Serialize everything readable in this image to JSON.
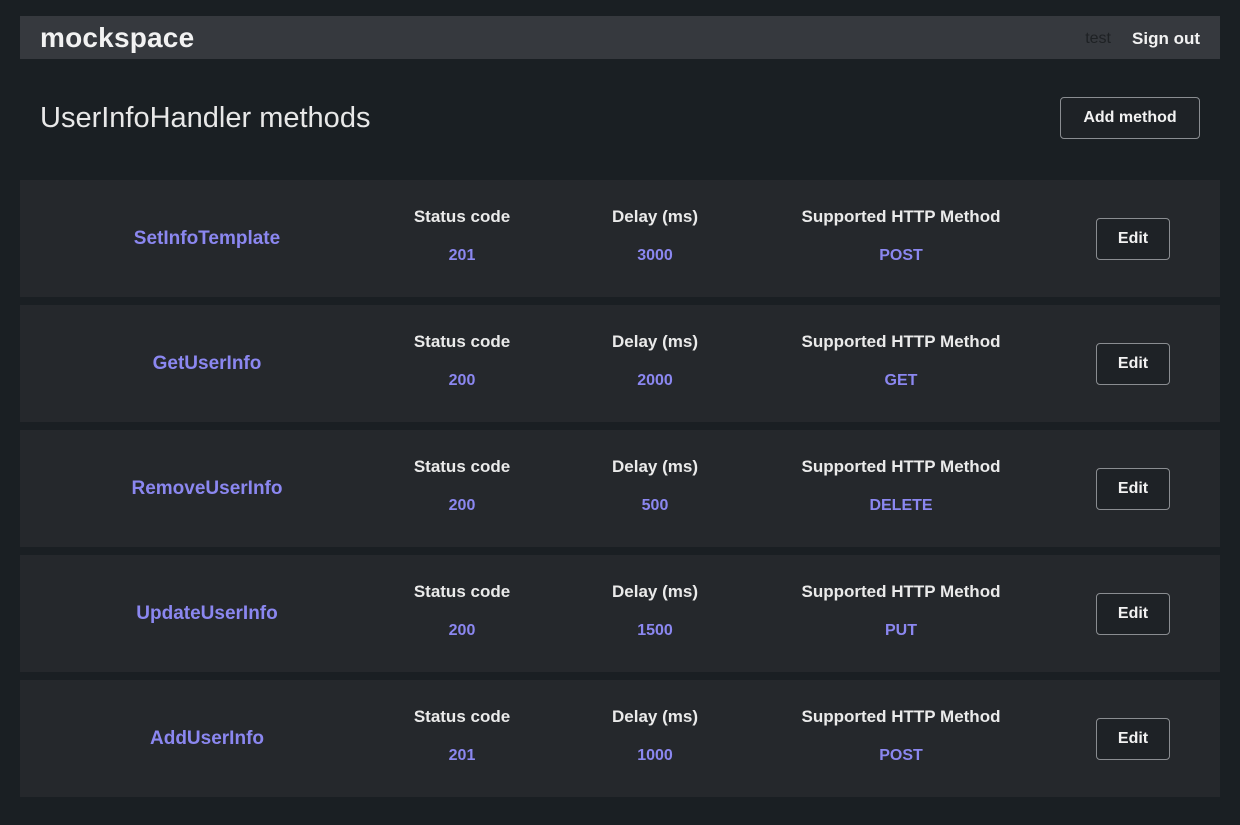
{
  "navbar": {
    "brand": "mockspace",
    "user": "test",
    "signout_label": "Sign out"
  },
  "header": {
    "title": "UserInfoHandler methods",
    "add_method_label": "Add method"
  },
  "labels": {
    "status_code": "Status code",
    "delay": "Delay (ms)",
    "http_method": "Supported HTTP Method",
    "edit": "Edit"
  },
  "methods": [
    {
      "name": "SetInfoTemplate",
      "status_code": "201",
      "delay": "3000",
      "http_method": "POST"
    },
    {
      "name": "GetUserInfo",
      "status_code": "200",
      "delay": "2000",
      "http_method": "GET"
    },
    {
      "name": "RemoveUserInfo",
      "status_code": "200",
      "delay": "500",
      "http_method": "DELETE"
    },
    {
      "name": "UpdateUserInfo",
      "status_code": "200",
      "delay": "1500",
      "http_method": "PUT"
    },
    {
      "name": "AddUserInfo",
      "status_code": "201",
      "delay": "1000",
      "http_method": "POST"
    }
  ],
  "colors": {
    "background": "#1a1f23",
    "navbar": "#36393e",
    "row": "#25282c",
    "accent": "#8b87f0"
  }
}
